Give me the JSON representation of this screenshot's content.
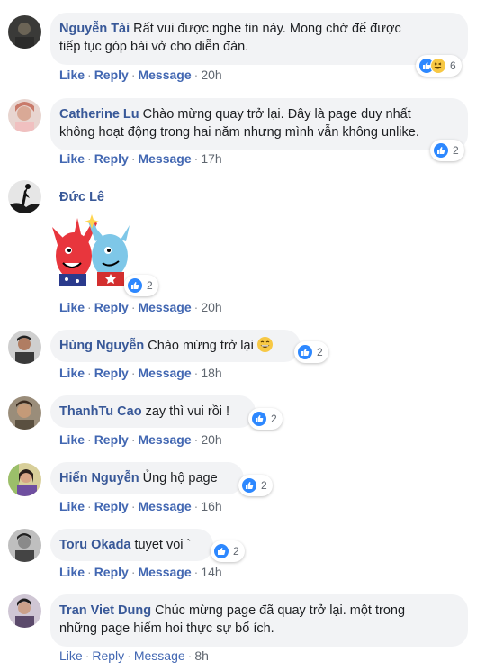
{
  "actions": {
    "like": "Like",
    "reply": "Reply",
    "message": "Message",
    "separator": "·"
  },
  "colors": {
    "author": "#385898",
    "link": "#4267b2",
    "bubble": "#f2f3f5",
    "like_blue": "#2d88ff"
  },
  "comments": [
    {
      "author": "Nguyễn Tài",
      "line1": "Rất vui được nghe tin này. Mong chờ để được",
      "line2": "tiếp tục góp bài vở cho diễn đàn.",
      "time": "20h",
      "reactions": "6",
      "reaction_icons": [
        "like-icon",
        "haha-icon"
      ]
    },
    {
      "author": "Catherine Lu",
      "line1": "Chào mừng quay trở lại. Đây là page duy nhất",
      "line2": "không hoạt động trong hai năm nhưng mình vẫn không unlike.",
      "time": "17h",
      "reactions": "2",
      "reaction_icons": [
        "like-icon"
      ]
    },
    {
      "author": "Đức Lê",
      "time": "20h",
      "reactions": "2",
      "reaction_icons": [
        "like-icon"
      ],
      "attachment": "sticker-high-five"
    },
    {
      "author": "Hùng Nguyễn",
      "text": "Chào mừng trở lại",
      "time": "18h",
      "reactions": "2",
      "reaction_icons": [
        "like-icon"
      ],
      "inline_emoji": "grinning-emoji"
    },
    {
      "author": "ThanhTu Cao",
      "text": "zay thì vui rồi !",
      "time": "20h",
      "reactions": "2",
      "reaction_icons": [
        "like-icon"
      ]
    },
    {
      "author": "Hiển Nguyễn",
      "text": "Ủng hộ page",
      "time": "16h",
      "reactions": "2",
      "reaction_icons": [
        "like-icon"
      ]
    },
    {
      "author": "Toru Okada",
      "text": "tuyet voi `",
      "time": "14h",
      "reactions": "2",
      "reaction_icons": [
        "like-icon"
      ]
    },
    {
      "author": "Tran Viet Dung",
      "line1": "Chúc mừng page đã quay trở lại. một trong",
      "line2": "những page hiếm hoi thực sự bổ ích.",
      "time": "8h"
    }
  ]
}
